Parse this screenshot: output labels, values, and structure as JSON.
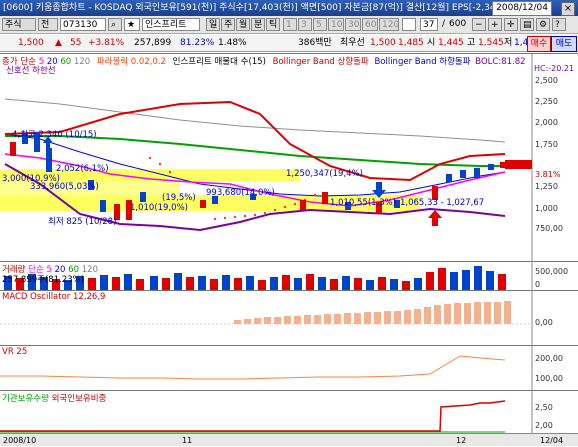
{
  "window": {
    "title": "[0600] 키움종합차트 - KOSDAQ 외국인보유[591(천)] 주식수[17,403(천)] 액면[500] 자본금[87(억)] 결산[12월] EPS[-2,34",
    "date": "2008/12/04",
    "close_glyph": "×"
  },
  "toolbar": {
    "market_label": "주식",
    "mode_label": "전",
    "code_value": "073130",
    "stock_name": "인스프리트",
    "period_labels": [
      "일",
      "주",
      "월",
      "분",
      "틱"
    ],
    "minute_options": [
      "1",
      "3",
      "5",
      "10",
      "30",
      "60",
      "120"
    ],
    "count_value": "37",
    "count_total": "600"
  },
  "quote": {
    "price": "1,500",
    "change": "55",
    "change_rate": "+3.81%",
    "volume": "257,899",
    "volume_rate": "81.23%",
    "turnover": "1.48%",
    "amount": "386백만",
    "best_ask_label": "최우선",
    "best_ask": "1,500",
    "best_bid": "1,485",
    "open_label": "시",
    "open": "1,445",
    "high_label": "고",
    "high": "1,545",
    "low_label": "저",
    "low": "1,415",
    "buy_label": "매수",
    "sell_label": "매도"
  },
  "price_panel": {
    "legend": {
      "ma_prefix": "종가 단순",
      "ma_periods": [
        "5",
        "20",
        "60",
        "120"
      ],
      "parabolic": "파라볼릭 0.02,0.2",
      "envelope": "인스프리트 매물대 수(15)",
      "bb_upper": "Bollinger Band 상향돌파",
      "bb_lower": "Bollinger Band 하향돌파",
      "bb_lc": "BOLC:81.82",
      "hc": "HC:-20.21",
      "signal": "신호선",
      "signal_alt": "하한선"
    },
    "y_ticks": [
      "2,500",
      "2,250",
      "2,000",
      "1,750",
      "1,500",
      "1,250",
      "1,000",
      "750,00"
    ],
    "current_price": "1,500",
    "current_change": "3.81%",
    "annotations": {
      "high": "4,최고 2,340 (10/15)",
      "a1": "2,052(6,1%)",
      "a2": "1,250,347(19,4%)",
      "a3": "333,960(5,03%)",
      "a4": "993,680(14,0%)",
      "a5": "(19,5%)",
      "a6": "1,010(19,0%)",
      "a7": "1,010,55(1,3%)",
      "a8": "1,065,33 - 1,027,67",
      "low": "최저 825 (10/28)",
      "side": "3,000(10,9%)"
    }
  },
  "volume_panel": {
    "legend_label": "거래량",
    "legend_ma": "단순",
    "ma_periods": [
      "5",
      "20",
      "60",
      "120"
    ],
    "current": "257,899주(81.23%)",
    "y_ticks": [
      "500,000",
      "0"
    ]
  },
  "macd_panel": {
    "legend": "MACD Oscillator 12,26,9",
    "y_ticks": [
      "0,00"
    ]
  },
  "vr_panel": {
    "legend": "VR 25",
    "y_ticks": [
      "200,00",
      "100,00"
    ]
  },
  "foreign_panel": {
    "legend_a": "기관보유수량",
    "legend_b": "외국인보유비중",
    "y_ticks": [
      "2,50",
      "2,00"
    ]
  },
  "date_axis": {
    "labels": [
      "2008/10",
      "11",
      "12",
      "12/04"
    ]
  },
  "colors": {
    "up": "#e00000",
    "down": "#0044cc",
    "ma5": "#ff00ff",
    "ma20": "#0000ff",
    "ma60": "#00a000",
    "ma120": "#808080",
    "bb_upper": "#e00000",
    "bb_lower": "#800080",
    "parabolic": "#ff4000",
    "volume_zone": "#ffff00",
    "macd": "#f5b090",
    "vr": "#ff8040",
    "foreign": "#e00000"
  }
}
